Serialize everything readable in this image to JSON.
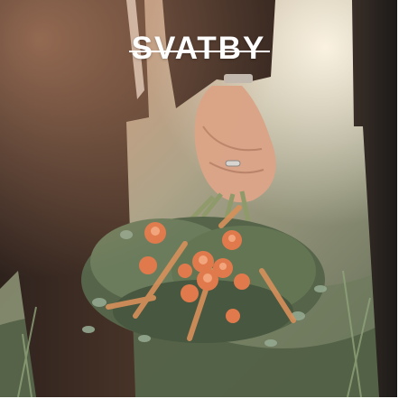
{
  "card": {
    "title": "SVATBY"
  },
  "colors": {
    "title_text": "#ffffff",
    "page_background": "#ffffff"
  }
}
